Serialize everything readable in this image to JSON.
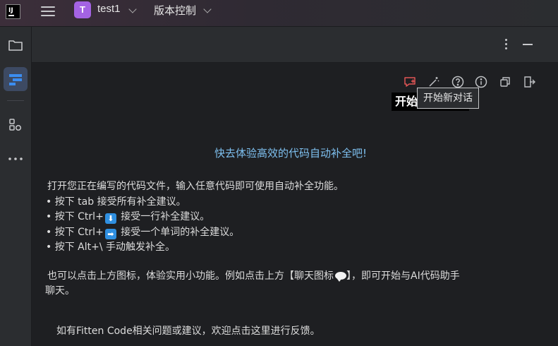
{
  "titlebar": {
    "logo_text": "IJ",
    "project_badge": "T",
    "project_name": "test1",
    "vcs_label": "版本控制"
  },
  "toolbar_icons": [
    "new-chat-icon",
    "magic-wand-icon",
    "help-icon",
    "info-icon",
    "copy-icon",
    "logout-icon"
  ],
  "chip_text": "开始",
  "tooltip": "开始新对话",
  "headline": "快去体验高效的代码自动补全吧!",
  "intro": "打开您正在编写的代码文件，输入任意代码即可使用自动补全功能。",
  "tips": {
    "t1": "• 按下 tab 接受所有补全建议。",
    "t2a": "• 按下 Ctrl+",
    "t2b": " 接受一行补全建议。",
    "t3a": "• 按下 Ctrl+",
    "t3b": " 接受一个单词的补全建议。",
    "t4": "• 按下 Alt+\\ 手动触发补全。"
  },
  "arrow_down": "⬇",
  "arrow_right": "➡",
  "extra_line1": "也可以点击上方图标，体验实用小功能。例如点击上方【聊天图标",
  "extra_line1_end": "】，即可开始与AI代码助手",
  "extra_line2": "聊天。",
  "feedback": "如有Fitten Code相关问题或建议，欢迎点击这里进行反馈。",
  "colors": {
    "accent_blue": "#7ec0f0",
    "new_chat_red": "#e05555",
    "badge_purple": "#a463e3"
  }
}
